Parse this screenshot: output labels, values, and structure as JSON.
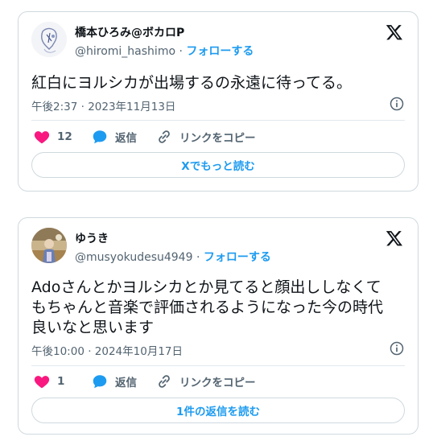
{
  "tweets": [
    {
      "display_name": "橋本ひろみ@ボカロP",
      "handle": "@hiromi_hashimo",
      "separator": "·",
      "follow_label": "フォローする",
      "text": "紅白にヨルシカが出場するの永遠に待ってる。",
      "timestamp": "午後2:37 · 2023年11月13日",
      "like_count": "12",
      "reply_label": "返信",
      "copy_link_label": "リンクをコピー",
      "more_button": "Xでもっと読む"
    },
    {
      "display_name": "ゆうき",
      "handle": "@musyokudesu4949",
      "separator": "·",
      "follow_label": "フォローする",
      "text_lines": [
        "Adoさんとかヨルシカとか見てると顔出ししなくて",
        "もちゃんと音楽で評価されるようになった今の時代",
        "良いなと思います"
      ],
      "timestamp": "午後10:00 · 2024年10月17日",
      "like_count": "1",
      "reply_label": "返信",
      "copy_link_label": "リンクをコピー",
      "more_button": "1件の返信を読む"
    }
  ],
  "colors": {
    "like": "#f91880",
    "reply": "#1d9bf0",
    "link": "#1d9bf0",
    "muted": "#536471",
    "border": "#cfd9de"
  },
  "icons": [
    "x-logo-icon",
    "heart-icon",
    "reply-bubble-icon",
    "link-icon",
    "info-icon"
  ]
}
